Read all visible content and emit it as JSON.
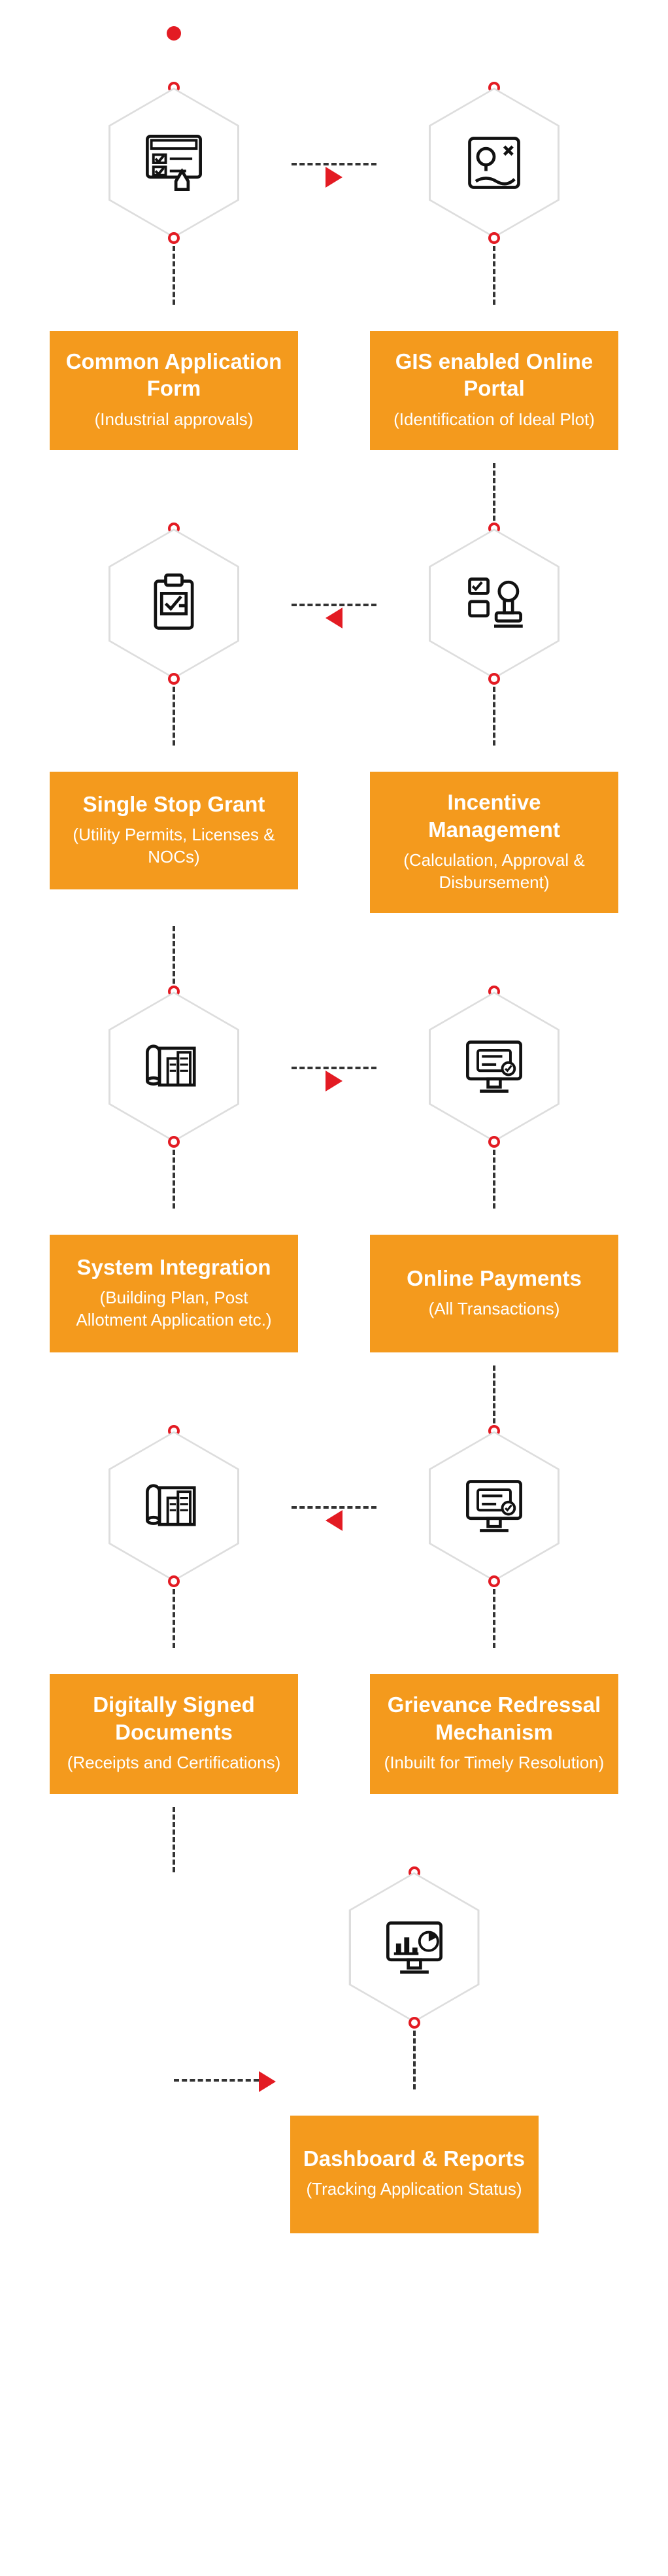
{
  "steps": [
    {
      "title": "Common Application Form",
      "sub": "(Industrial approvals)",
      "icon": "form"
    },
    {
      "title": "GIS enabled Online Portal",
      "sub": "(Identification of Ideal Plot)",
      "icon": "map"
    },
    {
      "title": "Single Stop Grant",
      "sub": "(Utility Permits, Licenses & NOCs)",
      "icon": "clipboard"
    },
    {
      "title": "Incentive Management",
      "sub": "(Calculation, Approval & Disbursement)",
      "icon": "stamp"
    },
    {
      "title": "System Integration",
      "sub": "(Building Plan, Post Allotment Application etc.)",
      "icon": "blueprint"
    },
    {
      "title": "Online Payments",
      "sub": "(All Transactions)",
      "icon": "monitor"
    },
    {
      "title": "Digitally Signed Documents",
      "sub": "(Receipts and Certifications)",
      "icon": "blueprint"
    },
    {
      "title": "Grievance Redressal Mechanism",
      "sub": "(Inbuilt for Timely Resolution)",
      "icon": "monitor"
    },
    {
      "title": "Dashboard & Reports",
      "sub": "(Tracking Application Status)",
      "icon": "dashboard"
    }
  ]
}
